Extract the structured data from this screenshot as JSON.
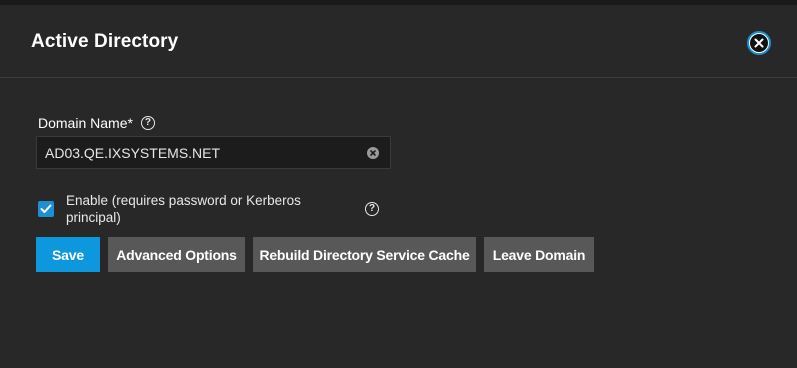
{
  "dialog": {
    "title": "Active Directory",
    "close_icon": "close-circle-icon"
  },
  "form": {
    "domain_name": {
      "label": "Domain Name*",
      "help_icon": "help-circle-icon",
      "value": "AD03.QE.IXSYSTEMS.NET",
      "clear_icon": "clear-circle-icon"
    },
    "enable": {
      "checked": true,
      "label": "Enable (requires password or Kerberos principal)",
      "help_icon": "help-circle-icon"
    }
  },
  "actions": {
    "save_label": "Save",
    "advanced_label": "Advanced Options",
    "rebuild_label": "Rebuild Directory Service Cache",
    "leave_label": "Leave Domain"
  },
  "colors": {
    "primary": "#0d97dd",
    "secondary_button": "#585858",
    "dialog_background": "#282828",
    "input_background": "#1c1c1c"
  }
}
